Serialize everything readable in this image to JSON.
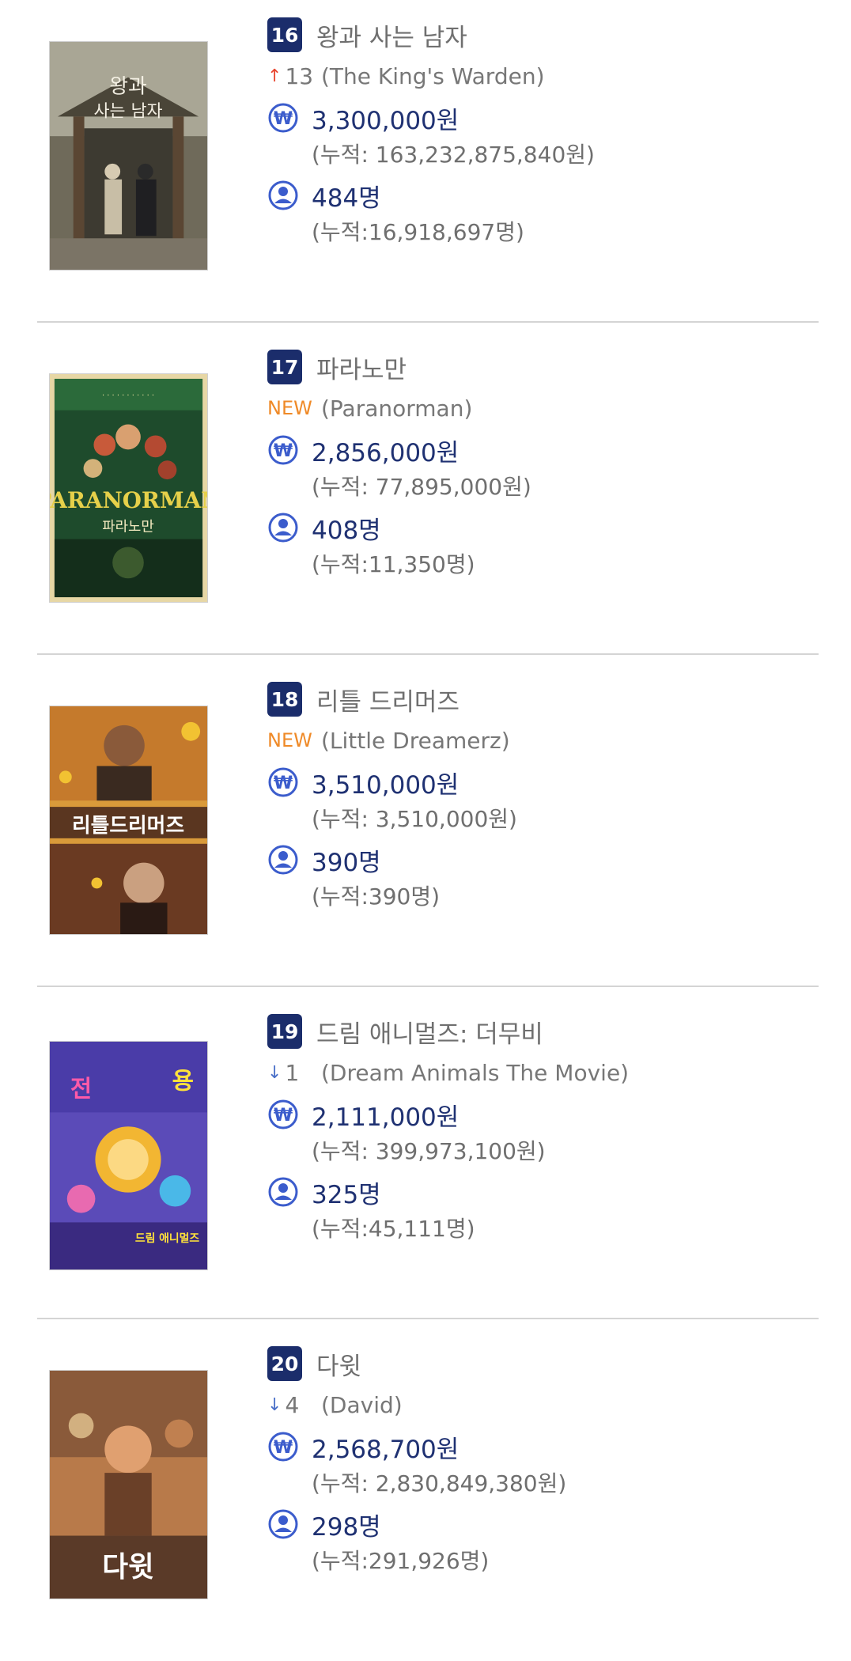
{
  "colors": {
    "rank_bg": "#1b2d6b",
    "new": "#ef8a28",
    "up_arrow": "#e8452f",
    "down_arrow": "#4a70c8",
    "value": "#1f3172",
    "icon": "#3b5ccc"
  },
  "movies": [
    {
      "rank": "16",
      "title": "왕과 사는 남자",
      "change_type": "up",
      "change_value": "13",
      "title_en": "(The King's Warden)",
      "revenue": "3,300,000원",
      "revenue_total": "(누적: 163,232,875,840원)",
      "audience": "484명",
      "audience_total": "(누적:16,918,697명)",
      "poster_icon": "poster-kings-warden"
    },
    {
      "rank": "17",
      "title": "파라노만",
      "change_type": "new",
      "change_value": "NEW",
      "title_en": "(Paranorman)",
      "revenue": "2,856,000원",
      "revenue_total": "(누적: 77,895,000원)",
      "audience": "408명",
      "audience_total": "(누적:11,350명)",
      "poster_icon": "poster-paranorman"
    },
    {
      "rank": "18",
      "title": "리틀 드리머즈",
      "change_type": "new",
      "change_value": "NEW",
      "title_en": "(Little Dreamerz)",
      "revenue": "3,510,000원",
      "revenue_total": "(누적: 3,510,000원)",
      "audience": "390명",
      "audience_total": "(누적:390명)",
      "poster_icon": "poster-little-dreamerz"
    },
    {
      "rank": "19",
      "title": "드림 애니멀즈: 더무비",
      "change_type": "down",
      "change_value": "1",
      "title_en": "(Dream Animals The Movie)",
      "revenue": "2,111,000원",
      "revenue_total": "(누적: 399,973,100원)",
      "audience": "325명",
      "audience_total": "(누적:45,111명)",
      "poster_icon": "poster-dream-animals"
    },
    {
      "rank": "20",
      "title": "다윗",
      "change_type": "down",
      "change_value": "4",
      "title_en": "(David)",
      "revenue": "2,568,700원",
      "revenue_total": "(누적: 2,830,849,380원)",
      "audience": "298명",
      "audience_total": "(누적:291,926명)",
      "poster_icon": "poster-david"
    }
  ]
}
